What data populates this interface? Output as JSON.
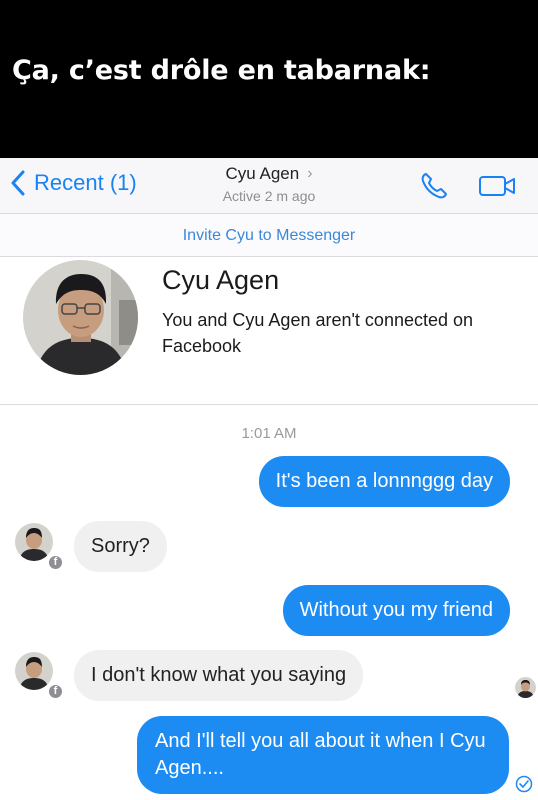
{
  "meme": {
    "caption": "Ça, c’est drôle en tabarnak:"
  },
  "navbar": {
    "back_label": "Recent (1)",
    "contact_name": "Cyu Agen",
    "active_status": "Active 2 m ago"
  },
  "invite": {
    "label": "Invite Cyu to Messenger"
  },
  "profile": {
    "name": "Cyu Agen",
    "subtitle": "You and Cyu Agen aren't connected on Facebook"
  },
  "conversation": {
    "timestamp": "1:01 AM",
    "messages": [
      {
        "sender": "me",
        "text": "It's been a lonnnggg day"
      },
      {
        "sender": "contact",
        "text": "Sorry?"
      },
      {
        "sender": "me",
        "text": "Without you my friend"
      },
      {
        "sender": "contact",
        "text": "I don't know what you saying"
      },
      {
        "sender": "me",
        "text": "And I'll tell you all about it when I Cyu Agen...."
      }
    ]
  },
  "colors": {
    "accent": "#1982f5",
    "outgoing_bubble": "#1c8cf3",
    "incoming_bubble": "#f1f0f0",
    "meme_background": "#000000"
  },
  "icons": [
    "back-chevron-icon",
    "phone-icon",
    "video-camera-icon",
    "facebook-badge-icon",
    "delivered-check-icon"
  ]
}
